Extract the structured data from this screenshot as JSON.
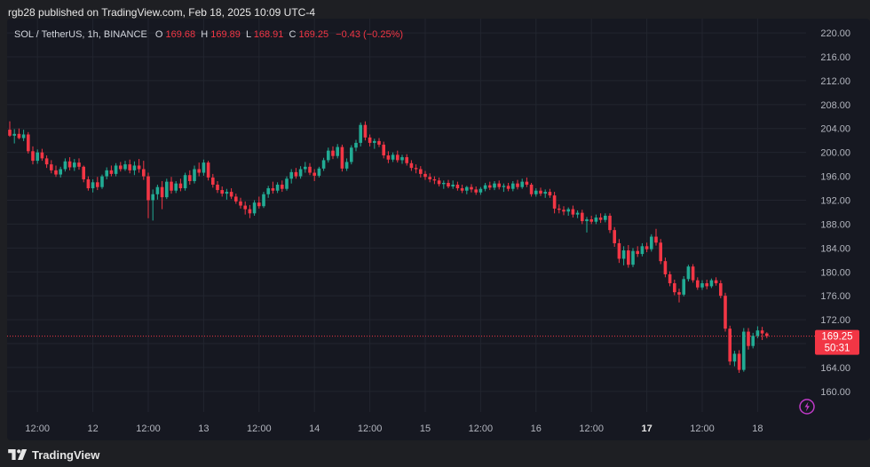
{
  "header": {
    "publish_line": "rgb28 published on TradingView.com, Feb 18, 2025 10:09 UTC-4"
  },
  "legend": {
    "symbol": "SOL / TetherUS, 1h, BINANCE",
    "o_label": "O",
    "o_value": "169.68",
    "h_label": "H",
    "h_value": "169.89",
    "l_label": "L",
    "l_value": "168.91",
    "c_label": "C",
    "c_value": "169.25",
    "change": "−0.43 (−0.25%)"
  },
  "price_tag": {
    "price": "169.25",
    "countdown": "50:31"
  },
  "footer": {
    "brand": "TradingView"
  },
  "colors": {
    "up": "#22ab94",
    "down": "#f23645",
    "background": "#161821",
    "grid": "#22252f",
    "axis_text": "#b2b5be",
    "legend_value": "#f23645"
  },
  "icons": {
    "replay": "lightning-icon",
    "brand": "tradingview-logo-icon"
  },
  "chart_data": {
    "type": "candlestick",
    "title": "SOL / TetherUS, 1h, BINANCE",
    "y_axis": {
      "side": "right",
      "ylim": [
        157.6,
        221.2
      ],
      "ticks": [
        "220.00",
        "216.00",
        "212.00",
        "208.00",
        "204.00",
        "200.00",
        "196.00",
        "192.00",
        "188.00",
        "184.00",
        "180.00",
        "176.00",
        "172.00",
        "168.00",
        "164.00",
        "160.00"
      ]
    },
    "x_axis": {
      "ticks": [
        {
          "label": "12:00",
          "bar": 6,
          "bold": false
        },
        {
          "label": "12",
          "bar": 18,
          "bold": false
        },
        {
          "label": "12:00",
          "bar": 30,
          "bold": false
        },
        {
          "label": "13",
          "bar": 42,
          "bold": false
        },
        {
          "label": "12:00",
          "bar": 54,
          "bold": false
        },
        {
          "label": "14",
          "bar": 66,
          "bold": false
        },
        {
          "label": "12:00",
          "bar": 78,
          "bold": false
        },
        {
          "label": "15",
          "bar": 90,
          "bold": false
        },
        {
          "label": "12:00",
          "bar": 102,
          "bold": false
        },
        {
          "label": "16",
          "bar": 114,
          "bold": false
        },
        {
          "label": "12:00",
          "bar": 126,
          "bold": false
        },
        {
          "label": "17",
          "bar": 138,
          "bold": true
        },
        {
          "label": "12:00",
          "bar": 150,
          "bold": false
        },
        {
          "label": "18",
          "bar": 162,
          "bold": false
        }
      ]
    },
    "last_price": 169.25,
    "grid": true,
    "candles": [
      {
        "o": 203.8,
        "h": 205.2,
        "l": 202.6,
        "c": 202.8
      },
      {
        "o": 202.8,
        "h": 203.9,
        "l": 201.5,
        "c": 203.1
      },
      {
        "o": 203.1,
        "h": 204.0,
        "l": 202.2,
        "c": 202.4
      },
      {
        "o": 202.4,
        "h": 203.8,
        "l": 201.9,
        "c": 203.0
      },
      {
        "o": 203.0,
        "h": 203.4,
        "l": 199.8,
        "c": 200.2
      },
      {
        "o": 200.2,
        "h": 201.0,
        "l": 198.0,
        "c": 198.6
      },
      {
        "o": 198.6,
        "h": 200.5,
        "l": 198.1,
        "c": 200.0
      },
      {
        "o": 200.0,
        "h": 200.6,
        "l": 198.6,
        "c": 199.0
      },
      {
        "o": 199.0,
        "h": 199.5,
        "l": 197.4,
        "c": 198.0
      },
      {
        "o": 198.0,
        "h": 198.7,
        "l": 196.5,
        "c": 197.0
      },
      {
        "o": 197.0,
        "h": 197.8,
        "l": 195.9,
        "c": 196.3
      },
      {
        "o": 196.3,
        "h": 197.6,
        "l": 195.8,
        "c": 197.2
      },
      {
        "o": 197.2,
        "h": 199.0,
        "l": 196.8,
        "c": 198.5
      },
      {
        "o": 198.5,
        "h": 199.2,
        "l": 197.0,
        "c": 197.5
      },
      {
        "o": 197.5,
        "h": 198.9,
        "l": 196.9,
        "c": 198.3
      },
      {
        "o": 198.3,
        "h": 199.0,
        "l": 197.1,
        "c": 197.6
      },
      {
        "o": 197.6,
        "h": 197.8,
        "l": 195.0,
        "c": 195.5
      },
      {
        "o": 195.5,
        "h": 196.0,
        "l": 193.6,
        "c": 194.0
      },
      {
        "o": 194.0,
        "h": 195.5,
        "l": 193.3,
        "c": 195.0
      },
      {
        "o": 195.0,
        "h": 195.9,
        "l": 193.7,
        "c": 194.2
      },
      {
        "o": 194.2,
        "h": 196.3,
        "l": 193.9,
        "c": 196.0
      },
      {
        "o": 196.0,
        "h": 197.5,
        "l": 195.5,
        "c": 197.0
      },
      {
        "o": 197.0,
        "h": 197.8,
        "l": 196.0,
        "c": 196.4
      },
      {
        "o": 196.4,
        "h": 198.2,
        "l": 196.0,
        "c": 197.8
      },
      {
        "o": 197.8,
        "h": 198.4,
        "l": 196.8,
        "c": 197.2
      },
      {
        "o": 197.2,
        "h": 198.6,
        "l": 196.9,
        "c": 198.0
      },
      {
        "o": 198.0,
        "h": 198.8,
        "l": 196.5,
        "c": 197.0
      },
      {
        "o": 197.0,
        "h": 198.5,
        "l": 196.2,
        "c": 197.8
      },
      {
        "o": 197.8,
        "h": 198.9,
        "l": 196.6,
        "c": 197.2
      },
      {
        "o": 197.2,
        "h": 198.6,
        "l": 195.4,
        "c": 196.0
      },
      {
        "o": 196.0,
        "h": 196.6,
        "l": 189.0,
        "c": 192.0
      },
      {
        "o": 192.0,
        "h": 193.8,
        "l": 188.6,
        "c": 193.0
      },
      {
        "o": 193.0,
        "h": 194.6,
        "l": 192.1,
        "c": 194.2
      },
      {
        "o": 194.2,
        "h": 195.2,
        "l": 190.5,
        "c": 192.5
      },
      {
        "o": 192.5,
        "h": 195.6,
        "l": 192.2,
        "c": 195.1
      },
      {
        "o": 195.1,
        "h": 195.9,
        "l": 193.1,
        "c": 193.6
      },
      {
        "o": 193.6,
        "h": 195.2,
        "l": 193.2,
        "c": 194.8
      },
      {
        "o": 194.8,
        "h": 195.6,
        "l": 193.5,
        "c": 194.0
      },
      {
        "o": 194.0,
        "h": 196.6,
        "l": 193.6,
        "c": 196.2
      },
      {
        "o": 196.2,
        "h": 197.0,
        "l": 194.6,
        "c": 195.2
      },
      {
        "o": 195.2,
        "h": 197.8,
        "l": 194.8,
        "c": 197.2
      },
      {
        "o": 197.2,
        "h": 198.3,
        "l": 196.0,
        "c": 196.6
      },
      {
        "o": 196.6,
        "h": 198.8,
        "l": 196.1,
        "c": 198.3
      },
      {
        "o": 198.3,
        "h": 198.6,
        "l": 195.3,
        "c": 195.8
      },
      {
        "o": 195.8,
        "h": 196.4,
        "l": 194.1,
        "c": 194.6
      },
      {
        "o": 194.6,
        "h": 195.2,
        "l": 193.2,
        "c": 193.7
      },
      {
        "o": 193.7,
        "h": 194.3,
        "l": 192.6,
        "c": 193.1
      },
      {
        "o": 193.1,
        "h": 193.9,
        "l": 192.1,
        "c": 193.4
      },
      {
        "o": 193.4,
        "h": 194.0,
        "l": 192.2,
        "c": 192.6
      },
      {
        "o": 192.6,
        "h": 193.1,
        "l": 191.4,
        "c": 191.8
      },
      {
        "o": 191.8,
        "h": 192.4,
        "l": 190.6,
        "c": 191.1
      },
      {
        "o": 191.1,
        "h": 191.8,
        "l": 189.6,
        "c": 190.5
      },
      {
        "o": 190.5,
        "h": 191.2,
        "l": 189.0,
        "c": 189.8
      },
      {
        "o": 189.8,
        "h": 192.0,
        "l": 189.4,
        "c": 191.6
      },
      {
        "o": 191.6,
        "h": 192.6,
        "l": 190.6,
        "c": 191.0
      },
      {
        "o": 191.0,
        "h": 193.4,
        "l": 190.7,
        "c": 193.0
      },
      {
        "o": 193.0,
        "h": 194.4,
        "l": 192.4,
        "c": 194.0
      },
      {
        "o": 194.0,
        "h": 195.1,
        "l": 193.1,
        "c": 193.6
      },
      {
        "o": 193.6,
        "h": 195.0,
        "l": 193.2,
        "c": 194.6
      },
      {
        "o": 194.6,
        "h": 195.3,
        "l": 193.4,
        "c": 193.9
      },
      {
        "o": 193.9,
        "h": 196.0,
        "l": 193.6,
        "c": 195.6
      },
      {
        "o": 195.6,
        "h": 197.2,
        "l": 194.8,
        "c": 196.7
      },
      {
        "o": 196.7,
        "h": 197.4,
        "l": 195.6,
        "c": 196.0
      },
      {
        "o": 196.0,
        "h": 197.7,
        "l": 195.6,
        "c": 197.2
      },
      {
        "o": 197.2,
        "h": 198.4,
        "l": 196.6,
        "c": 197.6
      },
      {
        "o": 197.6,
        "h": 198.2,
        "l": 196.2,
        "c": 196.6
      },
      {
        "o": 196.6,
        "h": 197.2,
        "l": 195.2,
        "c": 196.1
      },
      {
        "o": 196.1,
        "h": 197.6,
        "l": 195.8,
        "c": 197.3
      },
      {
        "o": 197.3,
        "h": 199.1,
        "l": 196.9,
        "c": 198.7
      },
      {
        "o": 198.7,
        "h": 200.8,
        "l": 198.3,
        "c": 200.3
      },
      {
        "o": 200.3,
        "h": 201.0,
        "l": 198.9,
        "c": 199.4
      },
      {
        "o": 199.4,
        "h": 201.4,
        "l": 199.0,
        "c": 200.9
      },
      {
        "o": 200.9,
        "h": 201.3,
        "l": 196.8,
        "c": 197.3
      },
      {
        "o": 197.3,
        "h": 199.0,
        "l": 196.9,
        "c": 198.4
      },
      {
        "o": 198.4,
        "h": 201.2,
        "l": 198.0,
        "c": 200.8
      },
      {
        "o": 200.8,
        "h": 202.1,
        "l": 200.2,
        "c": 201.6
      },
      {
        "o": 201.6,
        "h": 205.0,
        "l": 201.0,
        "c": 204.6
      },
      {
        "o": 204.6,
        "h": 205.2,
        "l": 202.0,
        "c": 202.5
      },
      {
        "o": 202.5,
        "h": 203.0,
        "l": 201.0,
        "c": 201.6
      },
      {
        "o": 201.6,
        "h": 202.3,
        "l": 200.6,
        "c": 201.9
      },
      {
        "o": 201.9,
        "h": 202.4,
        "l": 200.9,
        "c": 201.3
      },
      {
        "o": 201.3,
        "h": 201.8,
        "l": 199.0,
        "c": 199.5
      },
      {
        "o": 199.5,
        "h": 200.2,
        "l": 198.2,
        "c": 198.8
      },
      {
        "o": 198.8,
        "h": 200.0,
        "l": 198.4,
        "c": 199.6
      },
      {
        "o": 199.6,
        "h": 200.3,
        "l": 198.3,
        "c": 198.7
      },
      {
        "o": 198.7,
        "h": 199.6,
        "l": 198.1,
        "c": 199.2
      },
      {
        "o": 199.2,
        "h": 199.7,
        "l": 197.8,
        "c": 198.2
      },
      {
        "o": 198.2,
        "h": 198.7,
        "l": 196.9,
        "c": 197.4
      },
      {
        "o": 197.4,
        "h": 198.0,
        "l": 196.5,
        "c": 197.2
      },
      {
        "o": 197.2,
        "h": 197.7,
        "l": 195.8,
        "c": 196.4
      },
      {
        "o": 196.4,
        "h": 196.9,
        "l": 195.4,
        "c": 195.9
      },
      {
        "o": 195.9,
        "h": 196.5,
        "l": 195.0,
        "c": 195.5
      },
      {
        "o": 195.5,
        "h": 196.0,
        "l": 194.7,
        "c": 195.3
      },
      {
        "o": 195.3,
        "h": 195.8,
        "l": 194.3,
        "c": 194.7
      },
      {
        "o": 194.7,
        "h": 195.3,
        "l": 193.9,
        "c": 194.9
      },
      {
        "o": 194.9,
        "h": 195.4,
        "l": 194.0,
        "c": 194.3
      },
      {
        "o": 194.3,
        "h": 195.3,
        "l": 193.9,
        "c": 194.6
      },
      {
        "o": 194.6,
        "h": 195.1,
        "l": 193.6,
        "c": 194.0
      },
      {
        "o": 194.0,
        "h": 194.6,
        "l": 193.2,
        "c": 193.6
      },
      {
        "o": 193.6,
        "h": 194.4,
        "l": 193.0,
        "c": 194.2
      },
      {
        "o": 194.2,
        "h": 194.7,
        "l": 193.3,
        "c": 193.8
      },
      {
        "o": 193.8,
        "h": 194.3,
        "l": 192.9,
        "c": 193.3
      },
      {
        "o": 193.3,
        "h": 194.2,
        "l": 192.9,
        "c": 193.9
      },
      {
        "o": 193.9,
        "h": 194.9,
        "l": 193.5,
        "c": 194.5
      },
      {
        "o": 194.5,
        "h": 195.1,
        "l": 193.7,
        "c": 194.1
      },
      {
        "o": 194.1,
        "h": 195.2,
        "l": 193.7,
        "c": 194.8
      },
      {
        "o": 194.8,
        "h": 195.3,
        "l": 193.8,
        "c": 194.2
      },
      {
        "o": 194.2,
        "h": 194.8,
        "l": 193.4,
        "c": 194.4
      },
      {
        "o": 194.4,
        "h": 194.9,
        "l": 193.5,
        "c": 193.9
      },
      {
        "o": 193.9,
        "h": 195.2,
        "l": 193.5,
        "c": 194.8
      },
      {
        "o": 194.8,
        "h": 195.4,
        "l": 193.8,
        "c": 194.2
      },
      {
        "o": 194.2,
        "h": 195.6,
        "l": 193.9,
        "c": 195.1
      },
      {
        "o": 195.1,
        "h": 195.8,
        "l": 194.2,
        "c": 194.6
      },
      {
        "o": 194.6,
        "h": 194.9,
        "l": 192.6,
        "c": 193.0
      },
      {
        "o": 193.0,
        "h": 194.0,
        "l": 192.6,
        "c": 193.6
      },
      {
        "o": 193.6,
        "h": 194.1,
        "l": 192.7,
        "c": 193.1
      },
      {
        "o": 193.1,
        "h": 193.8,
        "l": 192.4,
        "c": 193.4
      },
      {
        "o": 193.4,
        "h": 193.9,
        "l": 192.4,
        "c": 192.8
      },
      {
        "o": 192.8,
        "h": 193.4,
        "l": 189.8,
        "c": 190.6
      },
      {
        "o": 190.6,
        "h": 191.3,
        "l": 189.8,
        "c": 190.4
      },
      {
        "o": 190.4,
        "h": 191.0,
        "l": 189.5,
        "c": 190.1
      },
      {
        "o": 190.1,
        "h": 190.8,
        "l": 189.4,
        "c": 190.5
      },
      {
        "o": 190.5,
        "h": 191.1,
        "l": 189.1,
        "c": 189.6
      },
      {
        "o": 189.6,
        "h": 190.3,
        "l": 189.0,
        "c": 189.9
      },
      {
        "o": 189.9,
        "h": 190.4,
        "l": 188.0,
        "c": 188.5
      },
      {
        "o": 188.5,
        "h": 189.2,
        "l": 186.6,
        "c": 188.8
      },
      {
        "o": 188.8,
        "h": 189.4,
        "l": 188.0,
        "c": 188.4
      },
      {
        "o": 188.4,
        "h": 189.6,
        "l": 188.0,
        "c": 189.1
      },
      {
        "o": 189.1,
        "h": 189.8,
        "l": 188.2,
        "c": 188.7
      },
      {
        "o": 188.7,
        "h": 189.8,
        "l": 188.3,
        "c": 189.4
      },
      {
        "o": 189.4,
        "h": 189.8,
        "l": 186.5,
        "c": 187.0
      },
      {
        "o": 187.0,
        "h": 187.5,
        "l": 184.2,
        "c": 184.8
      },
      {
        "o": 184.8,
        "h": 185.5,
        "l": 181.5,
        "c": 182.2
      },
      {
        "o": 182.2,
        "h": 184.3,
        "l": 181.1,
        "c": 183.6
      },
      {
        "o": 183.6,
        "h": 184.5,
        "l": 180.7,
        "c": 181.2
      },
      {
        "o": 181.2,
        "h": 184.0,
        "l": 180.8,
        "c": 183.5
      },
      {
        "o": 183.5,
        "h": 184.3,
        "l": 182.5,
        "c": 183.0
      },
      {
        "o": 183.0,
        "h": 184.8,
        "l": 182.6,
        "c": 184.3
      },
      {
        "o": 184.3,
        "h": 184.9,
        "l": 183.3,
        "c": 183.8
      },
      {
        "o": 183.8,
        "h": 186.3,
        "l": 183.4,
        "c": 185.9
      },
      {
        "o": 185.9,
        "h": 187.2,
        "l": 184.4,
        "c": 184.9
      },
      {
        "o": 184.9,
        "h": 185.5,
        "l": 181.3,
        "c": 181.8
      },
      {
        "o": 181.8,
        "h": 182.4,
        "l": 179.1,
        "c": 179.6
      },
      {
        "o": 179.6,
        "h": 180.1,
        "l": 177.6,
        "c": 178.1
      },
      {
        "o": 178.1,
        "h": 178.7,
        "l": 176.1,
        "c": 176.6
      },
      {
        "o": 176.6,
        "h": 177.2,
        "l": 174.9,
        "c": 176.2
      },
      {
        "o": 176.2,
        "h": 179.3,
        "l": 175.9,
        "c": 178.8
      },
      {
        "o": 178.8,
        "h": 181.2,
        "l": 178.4,
        "c": 180.9
      },
      {
        "o": 180.9,
        "h": 181.3,
        "l": 178.2,
        "c": 178.6
      },
      {
        "o": 178.6,
        "h": 179.1,
        "l": 177.0,
        "c": 177.4
      },
      {
        "o": 177.4,
        "h": 178.6,
        "l": 177.0,
        "c": 178.1
      },
      {
        "o": 178.1,
        "h": 178.7,
        "l": 177.1,
        "c": 177.6
      },
      {
        "o": 177.6,
        "h": 178.9,
        "l": 177.3,
        "c": 178.6
      },
      {
        "o": 178.6,
        "h": 179.1,
        "l": 177.7,
        "c": 178.1
      },
      {
        "o": 178.1,
        "h": 178.6,
        "l": 175.6,
        "c": 176.0
      },
      {
        "o": 176.0,
        "h": 176.5,
        "l": 170.0,
        "c": 170.5
      },
      {
        "o": 170.5,
        "h": 171.0,
        "l": 164.4,
        "c": 165.0
      },
      {
        "o": 165.0,
        "h": 166.8,
        "l": 164.2,
        "c": 166.3
      },
      {
        "o": 166.3,
        "h": 166.9,
        "l": 163.1,
        "c": 163.6
      },
      {
        "o": 163.6,
        "h": 170.6,
        "l": 163.3,
        "c": 170.0
      },
      {
        "o": 170.0,
        "h": 170.6,
        "l": 167.0,
        "c": 167.6
      },
      {
        "o": 167.6,
        "h": 169.8,
        "l": 167.2,
        "c": 169.3
      },
      {
        "o": 169.3,
        "h": 170.9,
        "l": 168.9,
        "c": 170.2
      },
      {
        "o": 170.2,
        "h": 170.8,
        "l": 168.6,
        "c": 169.7
      },
      {
        "o": 169.7,
        "h": 169.9,
        "l": 168.9,
        "c": 169.25
      }
    ]
  }
}
